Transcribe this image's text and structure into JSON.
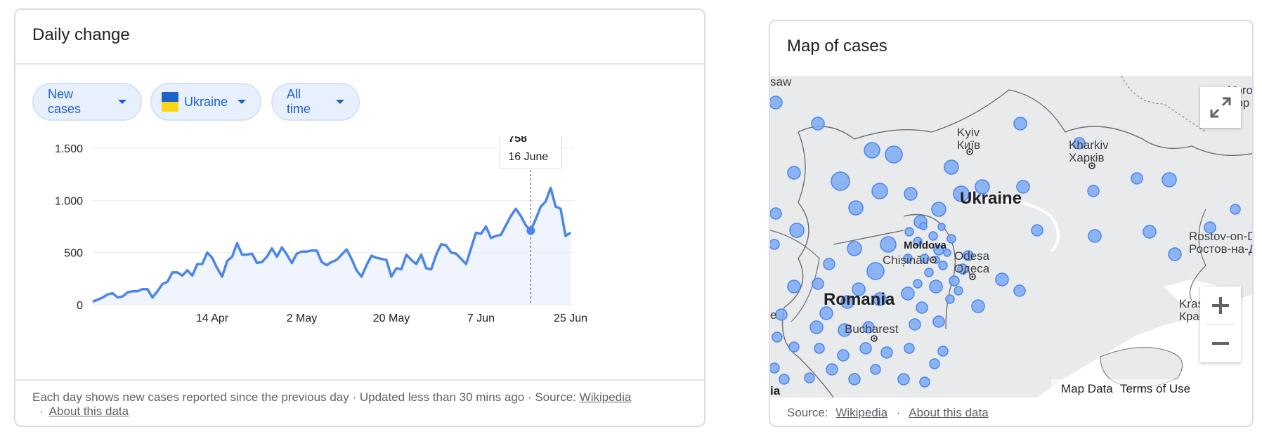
{
  "daily_change": {
    "title": "Daily change",
    "chips": {
      "metric": "New cases",
      "country": "Ukraine",
      "range": "All time"
    },
    "colors": {
      "line": "#4a86e8",
      "fill": "#e8f0fe",
      "chip_text": "#1a5fd0",
      "flag_blue": "#1b63c9",
      "flag_yellow": "#f9d716"
    },
    "tooltip": {
      "value": "758",
      "date": "16 June"
    },
    "footer": {
      "text": "Each day shows new cases reported since the previous day · Updated less than 30 mins ago  ·  Source:",
      "source_link": "Wikipedia",
      "separator": "·",
      "about_link": "About this data"
    }
  },
  "chart_data": {
    "type": "area",
    "ylim": [
      0,
      1500
    ],
    "yticks": [
      0,
      500,
      1000,
      1500
    ],
    "ytick_labels": [
      "0",
      "500",
      "1.000",
      "1.500"
    ],
    "xtick_labels": [
      "14 Apr",
      "2 May",
      "20 May",
      "7 Jun",
      "25 Jun"
    ],
    "xtick_days": [
      24,
      42,
      60,
      78,
      96
    ],
    "highlight_day": 88,
    "grid": true,
    "series": [
      {
        "values": [
          30,
          50,
          70,
          100,
          110,
          70,
          80,
          120,
          130,
          130,
          150,
          150,
          70,
          130,
          200,
          220,
          310,
          310,
          280,
          330,
          280,
          390,
          390,
          500,
          450,
          350,
          270,
          420,
          460,
          590,
          480,
          480,
          490,
          400,
          410,
          460,
          540,
          460,
          550,
          480,
          400,
          490,
          510,
          510,
          520,
          520,
          410,
          380,
          410,
          430,
          480,
          530,
          440,
          330,
          270,
          380,
          470,
          450,
          440,
          430,
          270,
          350,
          340,
          480,
          430,
          390,
          480,
          350,
          340,
          480,
          580,
          570,
          500,
          490,
          440,
          390,
          540,
          690,
          680,
          750,
          640,
          660,
          670,
          760,
          850,
          920,
          850,
          760,
          710,
          820,
          940,
          990,
          1120,
          940,
          920,
          660,
          690
        ]
      }
    ]
  },
  "map": {
    "title": "Map of cases",
    "labels": {
      "kyiv": "Kyiv",
      "kyiv_native": "Київ",
      "kharkiv": "Kharkiv",
      "kharkiv_native": "Харків",
      "ukraine": "Ukraine",
      "moldova": "Moldova",
      "chisinau": "Chișinău",
      "odesa": "Odesa",
      "odesa_native": "Одеса",
      "romania": "Romania",
      "bucharest": "Bucharest",
      "rostov": "Rostov-on-Do",
      "rostov_native": "Ростов-на-До",
      "voro": "Voro",
      "voro_native": "Вор",
      "krasn": "Krasn",
      "krasn_native": "Крас",
      "saw": "saw",
      "e_edge": "e",
      "ia_edge": "ia"
    },
    "attribution": {
      "map_data": "Map Data",
      "terms": "Terms of Use"
    },
    "footer": {
      "source_label": "Source:",
      "source_link": "Wikipedia",
      "separator": "·",
      "about_link": "About this data"
    },
    "colors": {
      "land": "#e9eaec",
      "water": "#ffffff",
      "bubble_fill": "#7baaf7",
      "bubble_stroke": "#4a86e8",
      "border": "#6b6e73"
    }
  }
}
